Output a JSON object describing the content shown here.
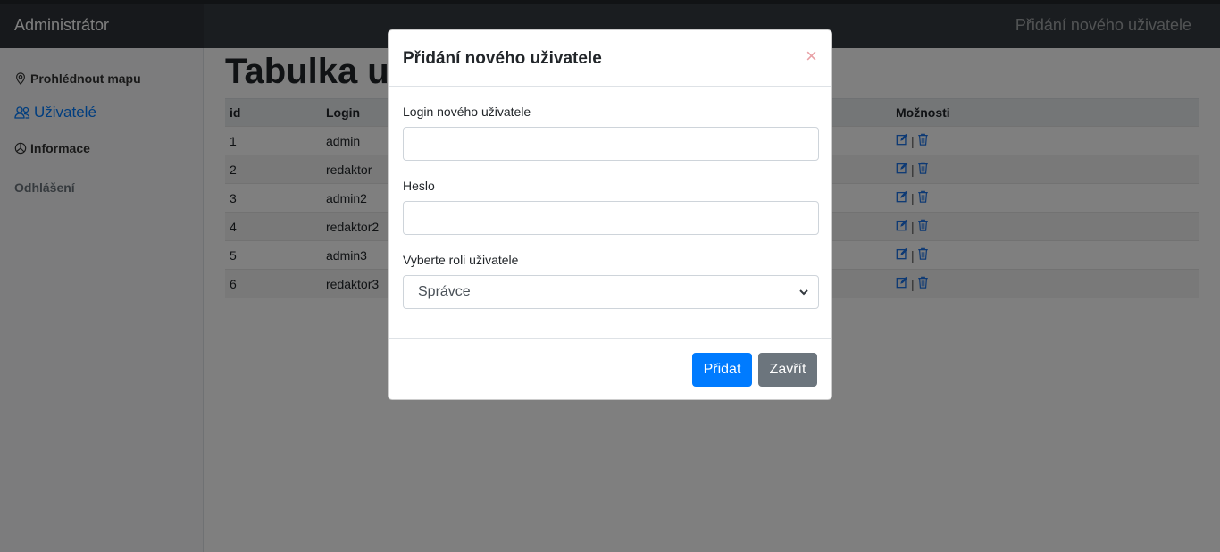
{
  "navbar": {
    "brand": "Administrátor",
    "title": "Přidání nového uživatele"
  },
  "sidebar": {
    "items": [
      {
        "label": "Prohlédnout mapu",
        "icon": "map-pin-icon"
      },
      {
        "label": "Uživatelé",
        "icon": "users-icon",
        "active": true
      },
      {
        "label": "Informace",
        "icon": "pie-chart-icon"
      }
    ],
    "logout": "Odhlášení"
  },
  "main": {
    "title": "Tabulka uživatelů",
    "table": {
      "headers": [
        "id",
        "Login",
        "Možnosti"
      ],
      "rows": [
        {
          "id": "1",
          "login": "admin"
        },
        {
          "id": "2",
          "login": "redaktor"
        },
        {
          "id": "3",
          "login": "admin2"
        },
        {
          "id": "4",
          "login": "redaktor2"
        },
        {
          "id": "5",
          "login": "admin3"
        },
        {
          "id": "6",
          "login": "redaktor3"
        }
      ],
      "separator": "|"
    }
  },
  "modal": {
    "title": "Přidání nového uživatele",
    "close": "×",
    "login_label": "Login nového uživatele",
    "login_value": "",
    "password_label": "Heslo",
    "password_value": "",
    "role_label": "Vyberte roli uživatele",
    "role_selected": "Správce",
    "submit": "Přidat",
    "cancel": "Zavřít"
  },
  "colors": {
    "accent": "#007bff",
    "secondary": "#6c757d",
    "navbar": "#343a40"
  }
}
